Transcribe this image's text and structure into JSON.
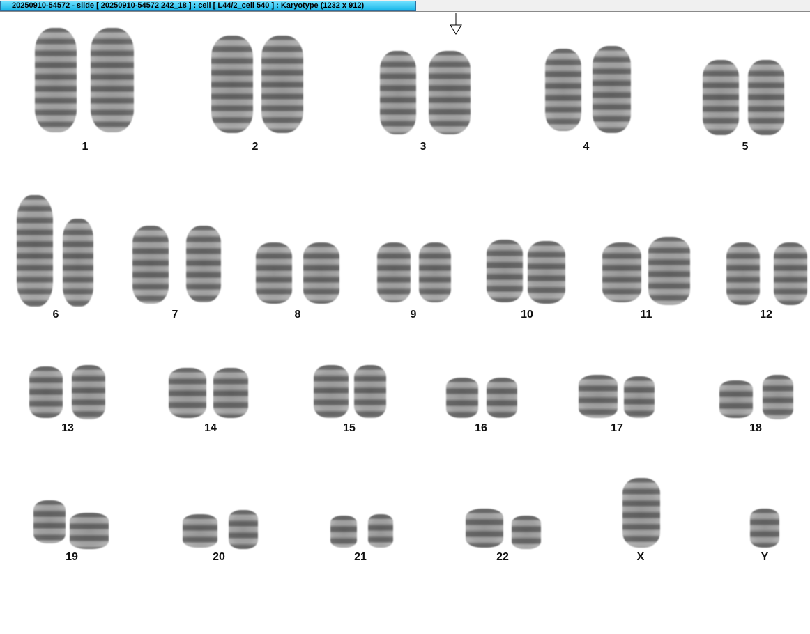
{
  "window": {
    "title": "20250910-54572 - slide [ 20250910-54572 242_18 ] : cell [ L44/2_cell 540 ] : Karyotype  (1232 x 912)"
  },
  "karyotype": {
    "labels": [
      "1",
      "2",
      "3",
      "4",
      "5",
      "6",
      "7",
      "8",
      "9",
      "10",
      "11",
      "12",
      "13",
      "14",
      "15",
      "16",
      "17",
      "18",
      "19",
      "20",
      "21",
      "22",
      "X",
      "Y"
    ],
    "marker_icon": "down-arrow-icon",
    "marker_chromosome": "3"
  },
  "colors": {
    "title_tab_light": "#6fe0ff",
    "title_tab_dark": "#17b6e8",
    "chromosome_gray": "#8c8c8c"
  }
}
